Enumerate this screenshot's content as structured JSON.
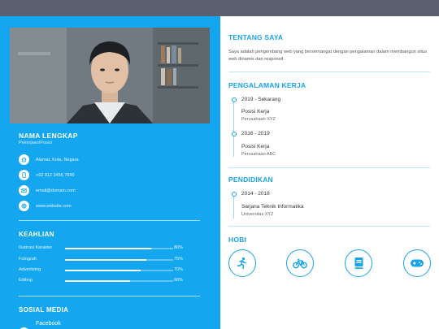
{
  "colors": {
    "sidebar": "#14a6ee",
    "accent": "#1aa3e6",
    "topbar": "#5b6070"
  },
  "profile": {
    "name": "NAMA LENGKAP",
    "job_title": "Pekerjaan/Posisi",
    "photo_icon": "profile-photo"
  },
  "contacts": [
    {
      "icon": "home-icon",
      "text": "Alamat, Kota, Negara"
    },
    {
      "icon": "phone-icon",
      "text": "+62 812 3456 7890"
    },
    {
      "icon": "email-icon",
      "text": "email@domain.com"
    },
    {
      "icon": "globe-icon",
      "text": "www.website.com"
    }
  ],
  "skills": {
    "heading": "KEAHLIAN",
    "items": [
      {
        "label": "Ilustrasi Karakter",
        "percent_text": "80%",
        "level": 80
      },
      {
        "label": "Fotografi",
        "percent_text": "75%",
        "level": 75
      },
      {
        "label": "Advertising",
        "percent_text": "70%",
        "level": 70
      },
      {
        "label": "Editing",
        "percent_text": "60%",
        "level": 60
      }
    ]
  },
  "social": {
    "heading": "SOSIAL MEDIA",
    "items": [
      {
        "icon": "facebook-icon",
        "label": "Facebook"
      }
    ]
  },
  "about": {
    "heading": "TENTANG SAYA",
    "text": "Saya adalah pengembang web yang bersemangat dengan pengalaman dalam membangun situs web dinamis dan responsif."
  },
  "experience": {
    "heading": "PENGALAMAN KERJA",
    "items": [
      {
        "period": "2019 - Sekarang",
        "role": "Posisi Kerja",
        "org": "Perusahaan XYZ"
      },
      {
        "period": "2016 - 2019",
        "role": "Posisi Kerja",
        "org": "Perusahaan ABC"
      }
    ]
  },
  "education": {
    "heading": "PENDIDIKAN",
    "items": [
      {
        "period": "2014 - 2018",
        "role": "Sarjana Teknik Informatika",
        "org": "Universitas XYZ"
      }
    ]
  },
  "hobbies": {
    "heading": "HOBI",
    "items": [
      {
        "icon": "running-icon"
      },
      {
        "icon": "bicycle-icon"
      },
      {
        "icon": "book-icon"
      },
      {
        "icon": "gamepad-icon"
      }
    ]
  }
}
